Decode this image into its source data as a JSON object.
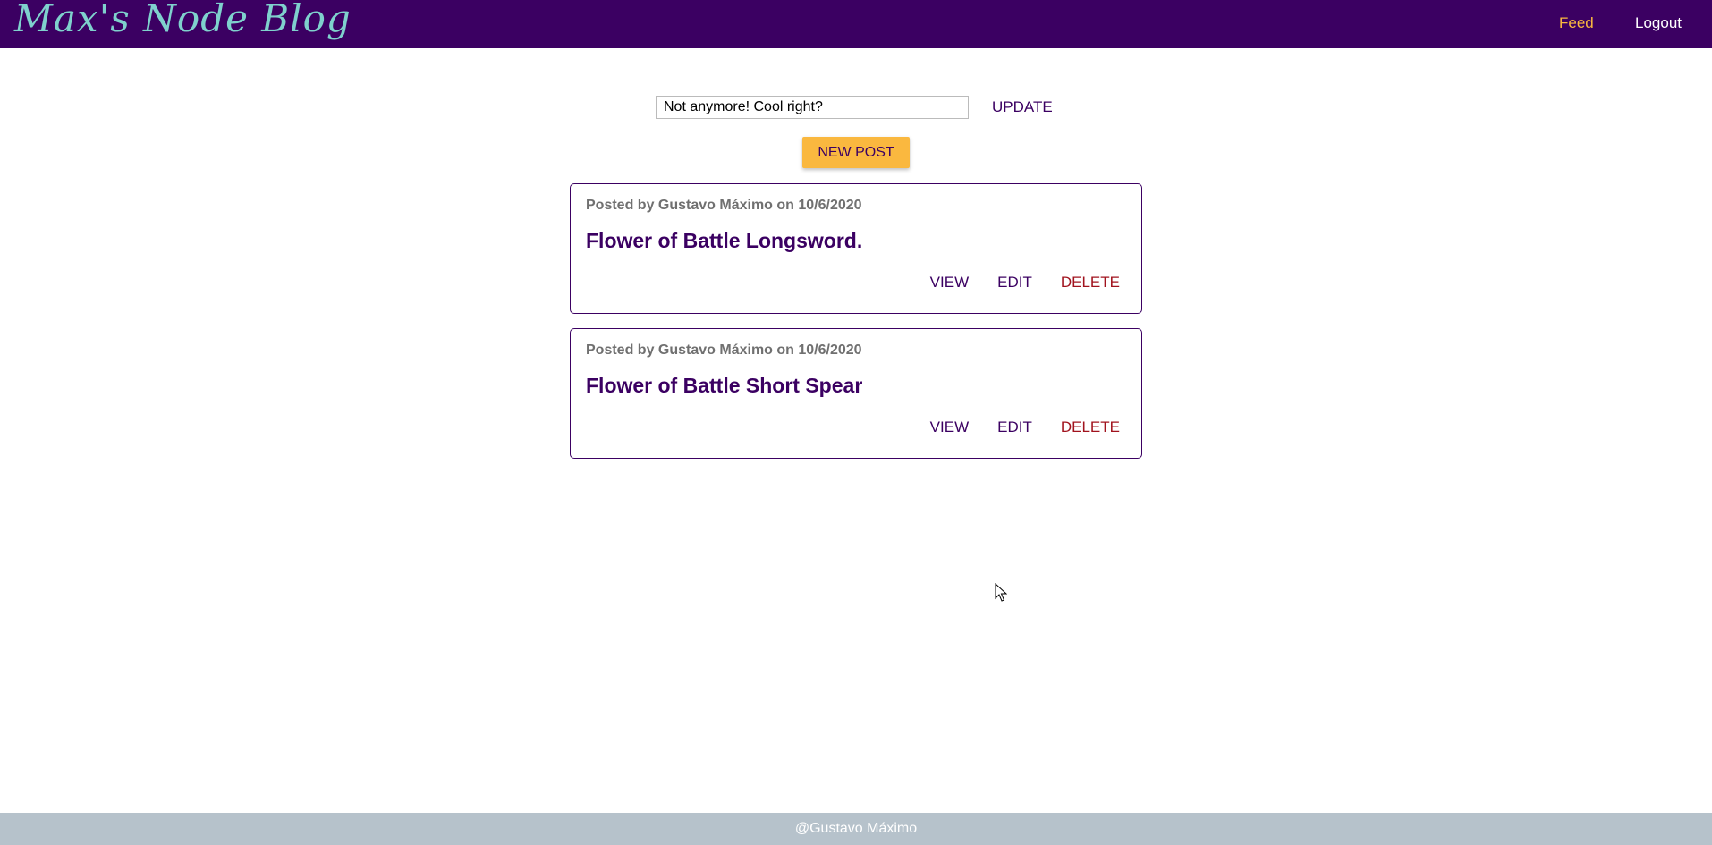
{
  "header": {
    "brand": "Max's Node Blog",
    "nav": {
      "feed_label": "Feed",
      "logout_label": "Logout"
    },
    "colors": {
      "background": "#3b0062",
      "feed_active": "#fab83f",
      "brand": "#7fd1cd"
    }
  },
  "status": {
    "input_value": "Not anymore! Cool right?",
    "update_label": "UPDATE"
  },
  "new_post_label": "NEW POST",
  "posts": [
    {
      "meta": "Posted by Gustavo Máximo on 10/6/2020",
      "title": "Flower of Battle Longsword.",
      "actions": {
        "view": "VIEW",
        "edit": "EDIT",
        "delete": "DELETE"
      }
    },
    {
      "meta": "Posted by Gustavo Máximo on 10/6/2020",
      "title": "Flower of Battle Short Spear",
      "actions": {
        "view": "VIEW",
        "edit": "EDIT",
        "delete": "DELETE"
      }
    }
  ],
  "footer": {
    "text": "@Gustavo Máximo"
  }
}
